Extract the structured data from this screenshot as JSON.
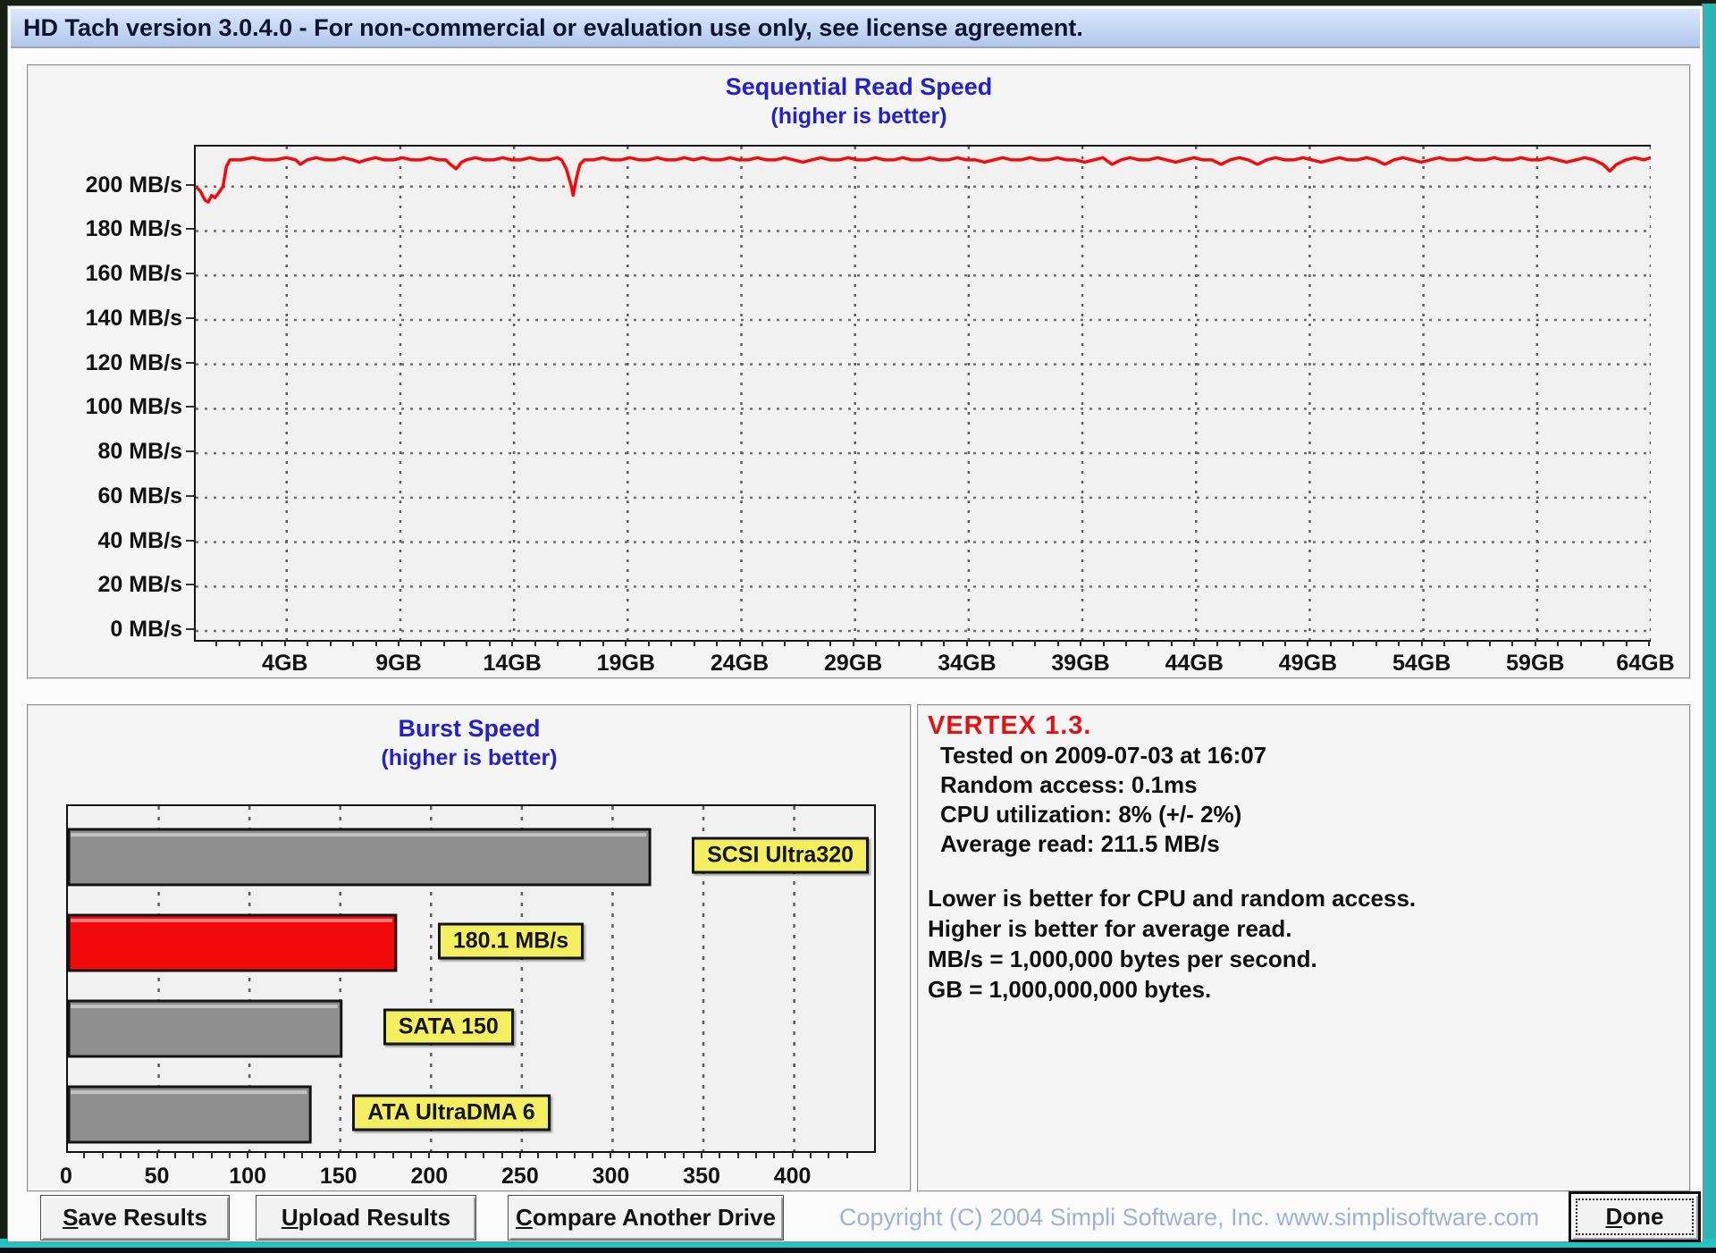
{
  "window": {
    "title": "HD Tach version 3.0.4.0  - For non-commercial or evaluation use only, see license agreement."
  },
  "chart_data": [
    {
      "type": "line",
      "title": "Sequential Read Speed",
      "subtitle": "(higher is better)",
      "xlim": [
        0,
        64
      ],
      "ylim": [
        -4,
        218
      ],
      "grid": "dashed",
      "x_ticks": [
        [
          4,
          "4GB"
        ],
        [
          9,
          "9GB"
        ],
        [
          14,
          "14GB"
        ],
        [
          19,
          "19GB"
        ],
        [
          24,
          "24GB"
        ],
        [
          29,
          "29GB"
        ],
        [
          34,
          "34GB"
        ],
        [
          39,
          "39GB"
        ],
        [
          44,
          "44GB"
        ],
        [
          49,
          "49GB"
        ],
        [
          54,
          "54GB"
        ],
        [
          59,
          "59GB"
        ],
        [
          64,
          "64GB"
        ]
      ],
      "y_ticks": [
        [
          0,
          "0 MB/s"
        ],
        [
          20,
          "20 MB/s"
        ],
        [
          40,
          "40 MB/s"
        ],
        [
          60,
          "60 MB/s"
        ],
        [
          80,
          "80 MB/s"
        ],
        [
          100,
          "100 MB/s"
        ],
        [
          120,
          "120 MB/s"
        ],
        [
          140,
          "140 MB/s"
        ],
        [
          160,
          "160 MB/s"
        ],
        [
          180,
          "180 MB/s"
        ],
        [
          200,
          "200 MB/s"
        ]
      ],
      "minor_tick_step": 1,
      "series": [
        {
          "name": "sequential-read-speed",
          "color": "#f40a0a",
          "points": [
            [
              0,
              200
            ],
            [
              0.2,
              198
            ],
            [
              0.4,
              194
            ],
            [
              0.55,
              193
            ],
            [
              0.7,
              196
            ],
            [
              0.85,
              195
            ],
            [
              1,
              197
            ],
            [
              1.2,
              200
            ],
            [
              1.35,
              209
            ],
            [
              1.5,
              212
            ],
            [
              2,
              212
            ],
            [
              2.5,
              213
            ],
            [
              3,
              212
            ],
            [
              3.5,
              212
            ],
            [
              4,
              213
            ],
            [
              4.4,
              212
            ],
            [
              4.6,
              210
            ],
            [
              4.9,
              212
            ],
            [
              5.3,
              213
            ],
            [
              5.7,
              212
            ],
            [
              6.1,
              212
            ],
            [
              6.5,
              213
            ],
            [
              6.9,
              212
            ],
            [
              7.2,
              211
            ],
            [
              7.5,
              212
            ],
            [
              7.9,
              213
            ],
            [
              8.3,
              212
            ],
            [
              8.7,
              212
            ],
            [
              9.1,
              213
            ],
            [
              9.5,
              212
            ],
            [
              9.9,
              212
            ],
            [
              10.3,
              213
            ],
            [
              10.7,
              212
            ],
            [
              11,
              212
            ],
            [
              11.2,
              210
            ],
            [
              11.45,
              208
            ],
            [
              11.7,
              211
            ],
            [
              11.9,
              212
            ],
            [
              12.3,
              213
            ],
            [
              12.7,
              212
            ],
            [
              13.1,
              212
            ],
            [
              13.5,
              213
            ],
            [
              13.9,
              212
            ],
            [
              14.3,
              212
            ],
            [
              14.7,
              213
            ],
            [
              15.1,
              212
            ],
            [
              15.5,
              212
            ],
            [
              15.9,
              213
            ],
            [
              16.1,
              212
            ],
            [
              16.3,
              208
            ],
            [
              16.5,
              201
            ],
            [
              16.6,
              196
            ],
            [
              16.75,
              204
            ],
            [
              16.9,
              210
            ],
            [
              17.1,
              212
            ],
            [
              17.5,
              212
            ],
            [
              17.9,
              213
            ],
            [
              18.3,
              212
            ],
            [
              18.7,
              212
            ],
            [
              19.1,
              213
            ],
            [
              19.5,
              212
            ],
            [
              19.9,
              212
            ],
            [
              20.3,
              213
            ],
            [
              20.7,
              212
            ],
            [
              21.1,
              212
            ],
            [
              21.5,
              213
            ],
            [
              21.9,
              212
            ],
            [
              22.3,
              213
            ],
            [
              22.7,
              212
            ],
            [
              23.1,
              212
            ],
            [
              23.5,
              213
            ],
            [
              23.9,
              212
            ],
            [
              24.3,
              212
            ],
            [
              24.7,
              213
            ],
            [
              25.1,
              212
            ],
            [
              25.5,
              212
            ],
            [
              25.9,
              213
            ],
            [
              26.3,
              212
            ],
            [
              26.7,
              211
            ],
            [
              27.1,
              212
            ],
            [
              27.5,
              213
            ],
            [
              27.9,
              212
            ],
            [
              28.3,
              212
            ],
            [
              28.7,
              213
            ],
            [
              29.1,
              212
            ],
            [
              29.5,
              212
            ],
            [
              29.9,
              213
            ],
            [
              30.3,
              212
            ],
            [
              30.7,
              212
            ],
            [
              31.1,
              213
            ],
            [
              31.5,
              212
            ],
            [
              31.9,
              212
            ],
            [
              32.3,
              213
            ],
            [
              32.7,
              212
            ],
            [
              33.1,
              212
            ],
            [
              33.5,
              213
            ],
            [
              33.9,
              212
            ],
            [
              34.3,
              212
            ],
            [
              34.7,
              211
            ],
            [
              35.1,
              212
            ],
            [
              35.5,
              213
            ],
            [
              35.9,
              212
            ],
            [
              36.3,
              212
            ],
            [
              36.7,
              213
            ],
            [
              37.1,
              212
            ],
            [
              37.5,
              212
            ],
            [
              37.9,
              213
            ],
            [
              38.3,
              212
            ],
            [
              38.7,
              212
            ],
            [
              39.1,
              211
            ],
            [
              39.5,
              212
            ],
            [
              39.9,
              213
            ],
            [
              40.3,
              210
            ],
            [
              40.7,
              212
            ],
            [
              41.1,
              213
            ],
            [
              41.5,
              212
            ],
            [
              41.9,
              212
            ],
            [
              42.3,
              213
            ],
            [
              42.7,
              212
            ],
            [
              43.1,
              211
            ],
            [
              43.5,
              212
            ],
            [
              43.9,
              213
            ],
            [
              44.3,
              212
            ],
            [
              44.7,
              212
            ],
            [
              45.1,
              210
            ],
            [
              45.5,
              212
            ],
            [
              45.9,
              213
            ],
            [
              46.3,
              212
            ],
            [
              46.7,
              210
            ],
            [
              47.1,
              212
            ],
            [
              47.5,
              213
            ],
            [
              47.9,
              212
            ],
            [
              48.3,
              212
            ],
            [
              48.7,
              213
            ],
            [
              49.1,
              212
            ],
            [
              49.5,
              211
            ],
            [
              49.9,
              212
            ],
            [
              50.3,
              213
            ],
            [
              50.7,
              212
            ],
            [
              51.1,
              212
            ],
            [
              51.5,
              213
            ],
            [
              51.9,
              212
            ],
            [
              52.3,
              210
            ],
            [
              52.7,
              212
            ],
            [
              53.1,
              213
            ],
            [
              53.5,
              212
            ],
            [
              53.9,
              211
            ],
            [
              54.3,
              212
            ],
            [
              54.7,
              213
            ],
            [
              55.1,
              212
            ],
            [
              55.5,
              212
            ],
            [
              55.9,
              213
            ],
            [
              56.3,
              212
            ],
            [
              56.7,
              212
            ],
            [
              57.1,
              213
            ],
            [
              57.5,
              212
            ],
            [
              57.9,
              212
            ],
            [
              58.3,
              213
            ],
            [
              58.7,
              212
            ],
            [
              59.1,
              212
            ],
            [
              59.5,
              213
            ],
            [
              59.9,
              212
            ],
            [
              60.3,
              211
            ],
            [
              60.7,
              212
            ],
            [
              61.1,
              213
            ],
            [
              61.5,
              212
            ],
            [
              61.9,
              210
            ],
            [
              62.2,
              207
            ],
            [
              62.5,
              210
            ],
            [
              62.9,
              212
            ],
            [
              63.3,
              213
            ],
            [
              63.7,
              212
            ],
            [
              64,
              213
            ]
          ]
        }
      ]
    },
    {
      "type": "bar",
      "title": "Burst Speed",
      "subtitle": "(higher is better)",
      "orientation": "horizontal",
      "xlim": [
        0,
        444
      ],
      "grid": "dashed",
      "x_ticks": [
        [
          0,
          "0"
        ],
        [
          50,
          "50"
        ],
        [
          100,
          "100"
        ],
        [
          150,
          "150"
        ],
        [
          200,
          "200"
        ],
        [
          250,
          "250"
        ],
        [
          300,
          "300"
        ],
        [
          350,
          "350"
        ],
        [
          400,
          "400"
        ]
      ],
      "minor_tick_step": 10,
      "bars": [
        {
          "label": "SCSI Ultra320",
          "value": 320,
          "color": "#8f8f8f"
        },
        {
          "label": "180.1 MB/s",
          "value": 180.1,
          "color": "#f40a0a"
        },
        {
          "label": "SATA 150",
          "value": 150,
          "color": "#8f8f8f"
        },
        {
          "label": "ATA UltraDMA 6",
          "value": 133,
          "color": "#8f8f8f"
        }
      ],
      "label_bg": "#f3ef60"
    }
  ],
  "info_panel": {
    "drive_name": "VERTEX 1.3.",
    "drive_name_color": "#e31212",
    "details": [
      "Tested on 2009-07-03 at 16:07",
      "Random access: 0.1ms",
      "CPU utilization: 8% (+/- 2%)",
      "Average read: 211.5 MB/s"
    ],
    "notes": [
      "Lower is better for CPU and random access.",
      "Higher is better for average read.",
      "MB/s = 1,000,000 bytes per second.",
      "GB = 1,000,000,000 bytes."
    ]
  },
  "buttons": {
    "save": "Save Results",
    "upload": "Upload Results",
    "compare": "Compare Another Drive",
    "done": "Done"
  },
  "footer": {
    "copyright": "Copyright (C) 2004 Simpli Software, Inc. www.simplisoftware.com"
  }
}
